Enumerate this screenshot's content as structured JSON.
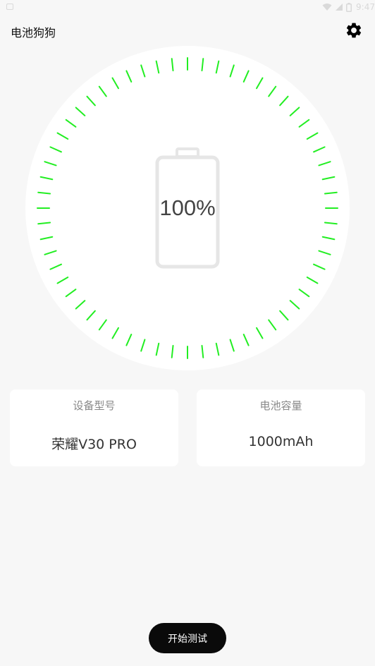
{
  "status_bar": {
    "time": "9:47",
    "icons": [
      "notification-icon",
      "wifi-icon",
      "signal-icon",
      "battery-icon"
    ]
  },
  "header": {
    "title": "电池狗狗",
    "settings_icon": "gear-icon"
  },
  "dial": {
    "percentage_text": "100%",
    "level": 1.0,
    "tick_color": "#22ee22",
    "battery_icon": "battery-outline-icon"
  },
  "cards": [
    {
      "label": "设备型号",
      "value": "荣耀V30 PRO"
    },
    {
      "label": "电池容量",
      "value": "1000mAh"
    }
  ],
  "start_button": {
    "label": "开始测试"
  },
  "colors": {
    "background": "#f7f7f7",
    "card": "#ffffff",
    "button": "#0a0a0a",
    "accent_green": "#22ee22"
  }
}
